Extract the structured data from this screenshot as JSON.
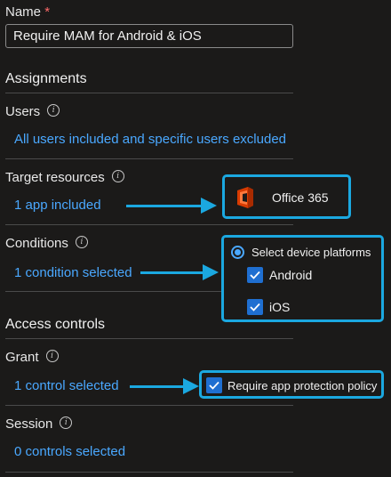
{
  "name": {
    "label": "Name",
    "required_mark": "*",
    "value": "Require MAM for Android & iOS"
  },
  "assignments": {
    "heading": "Assignments",
    "users": {
      "label": "Users",
      "link": "All users included and specific users excluded"
    },
    "target_resources": {
      "label": "Target resources",
      "link": "1 app included"
    },
    "conditions": {
      "label": "Conditions",
      "link": "1 condition selected"
    }
  },
  "access_controls": {
    "heading": "Access controls",
    "grant": {
      "label": "Grant",
      "link": "1 control selected"
    },
    "session": {
      "label": "Session",
      "link": "0 controls selected"
    }
  },
  "callouts": {
    "office": {
      "app_name": "Office 365",
      "icon": "office-logo"
    },
    "platforms": {
      "title": "Select device platforms",
      "options": [
        "Android",
        "iOS"
      ]
    },
    "grant": {
      "text": "Require app protection policy"
    }
  },
  "info_icon_glyph": "i",
  "colors": {
    "accent_link": "#4aa8ff",
    "callout_border": "#1ba8e0",
    "checkbox": "#1f6fd1",
    "required": "#ff6b6b"
  }
}
